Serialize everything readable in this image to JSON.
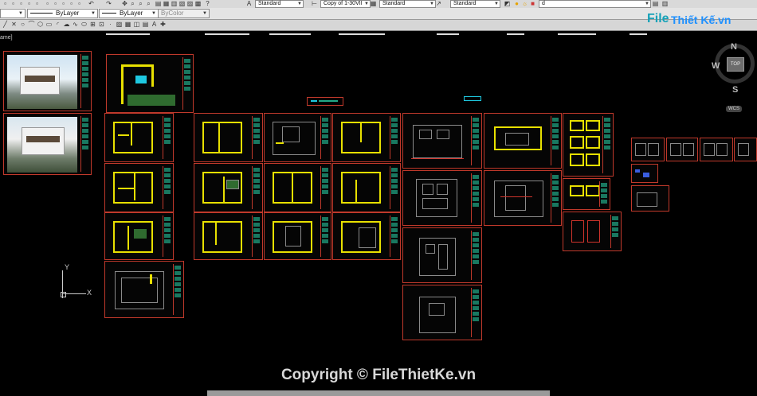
{
  "toolbar": {
    "layer_row1_label": "",
    "style_text": "Standard",
    "dimstyle": "Copy of 1-30VII",
    "table_style": "Standard",
    "mleader_style": "Standard",
    "layer_name": "d"
  },
  "properties": {
    "linetype_left": "ByLayer",
    "linetype_right": "ByLayer",
    "color": "ByColor"
  },
  "model_space_label": "ame]",
  "viewcube": {
    "north": "N",
    "west": "W",
    "south": "S",
    "face": "TOP",
    "wcs": "WCS"
  },
  "ucs": {
    "x": "X",
    "y": "Y"
  },
  "watermark": {
    "logo_part1": "File",
    "logo_part2": "Thiết Kế.vn",
    "copyright": "Copyright © FileThietKe.vn"
  },
  "colors": {
    "sheet_border": "#c0392b",
    "wall": "#e8e000",
    "background": "#000000"
  }
}
